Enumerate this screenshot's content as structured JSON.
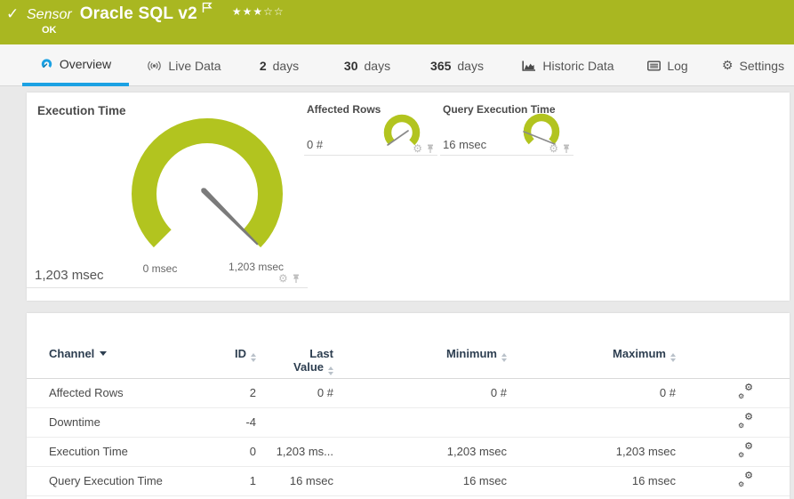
{
  "header": {
    "check_icon": "✓",
    "kind_label": "Sensor",
    "title": "Oracle SQL v2",
    "stars": "★★★☆☆",
    "status": "OK"
  },
  "tabs": {
    "overview": "Overview",
    "live_data": "Live Data",
    "d2_num": "2",
    "d2_unit": "days",
    "d30_num": "30",
    "d30_unit": "days",
    "d365_num": "365",
    "d365_unit": "days",
    "historic": "Historic Data",
    "log": "Log",
    "settings": "Settings",
    "settings_gear_icon": "⚙"
  },
  "gauges": {
    "primary": {
      "title": "Execution Time",
      "value": "1,203 msec",
      "scale_min": "0 msec",
      "scale_max": "1,203 msec"
    },
    "affected_rows": {
      "title": "Affected Rows",
      "value": "0 #"
    },
    "query_exec": {
      "title": "Query Execution Time",
      "value": "16 msec"
    },
    "gear_icon": "⚙"
  },
  "table": {
    "headers": {
      "channel": "Channel",
      "id": "ID",
      "last_line1": "Last",
      "last_line2": "Value",
      "min": "Minimum",
      "max": "Maximum"
    },
    "gear_icon": "⚙",
    "rows": [
      {
        "channel": "Affected Rows",
        "id": "2",
        "last": "0 #",
        "min": "0 #",
        "max": "0 #"
      },
      {
        "channel": "Downtime",
        "id": "-4",
        "last": "",
        "min": "",
        "max": ""
      },
      {
        "channel": "Execution Time",
        "id": "0",
        "last": "1,203 ms...",
        "min": "1,203 msec",
        "max": "1,203 msec"
      },
      {
        "channel": "Query Execution Time",
        "id": "1",
        "last": "16 msec",
        "min": "16 msec",
        "max": "16 msec"
      }
    ]
  },
  "colors": {
    "brand_green": "#a9b721",
    "gauge_green": "#b2c41f",
    "accent_blue": "#1ba1e3"
  }
}
